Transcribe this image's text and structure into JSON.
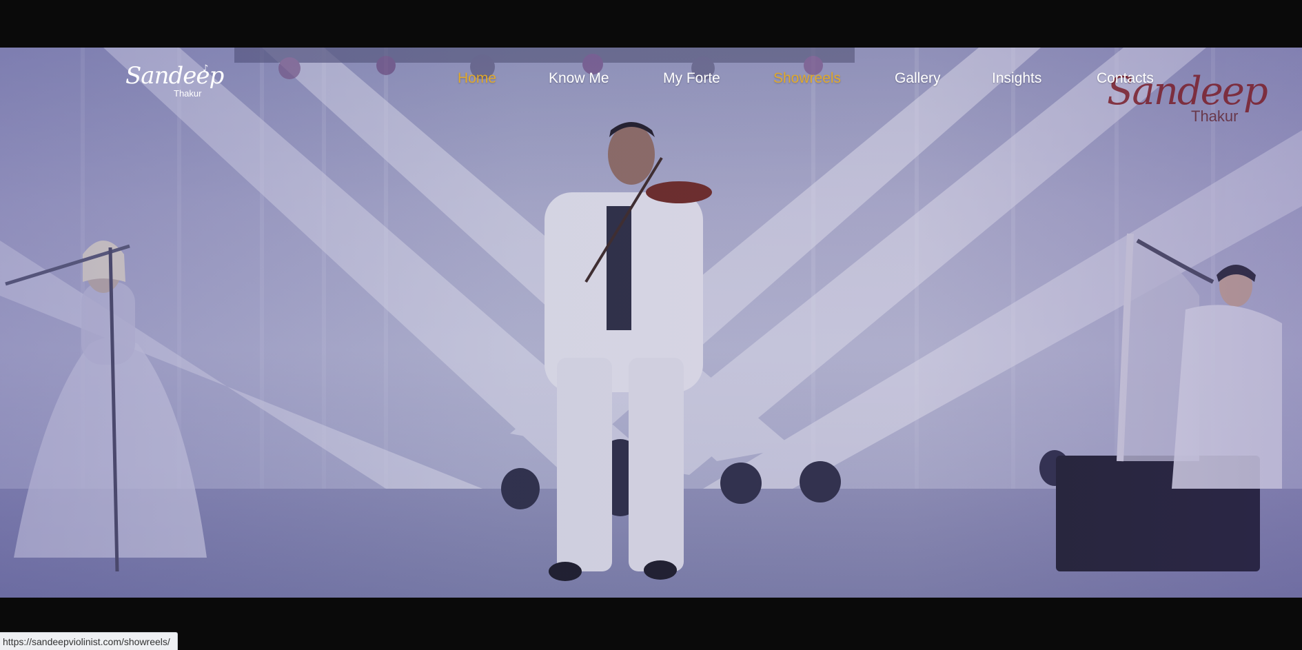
{
  "logo": {
    "name": "Sandeep",
    "surname": "Thakur"
  },
  "watermark_logo": {
    "name": "Sandeep",
    "surname": "Thakur"
  },
  "nav": {
    "items": [
      {
        "label": "Home",
        "active": true
      },
      {
        "label": "Know Me",
        "active": false
      },
      {
        "label": "My Forte",
        "active": false
      },
      {
        "label": "Showreels",
        "active": true
      },
      {
        "label": "Gallery",
        "active": false
      },
      {
        "label": "Insights",
        "active": false
      },
      {
        "label": "Contacts",
        "active": false
      }
    ]
  },
  "status_bar": {
    "url": "https://sandeepviolinist.com/showreels/"
  },
  "colors": {
    "accent": "#e0a92d",
    "nav_text": "#ffffff",
    "letterbox": "#0a0a0a"
  }
}
